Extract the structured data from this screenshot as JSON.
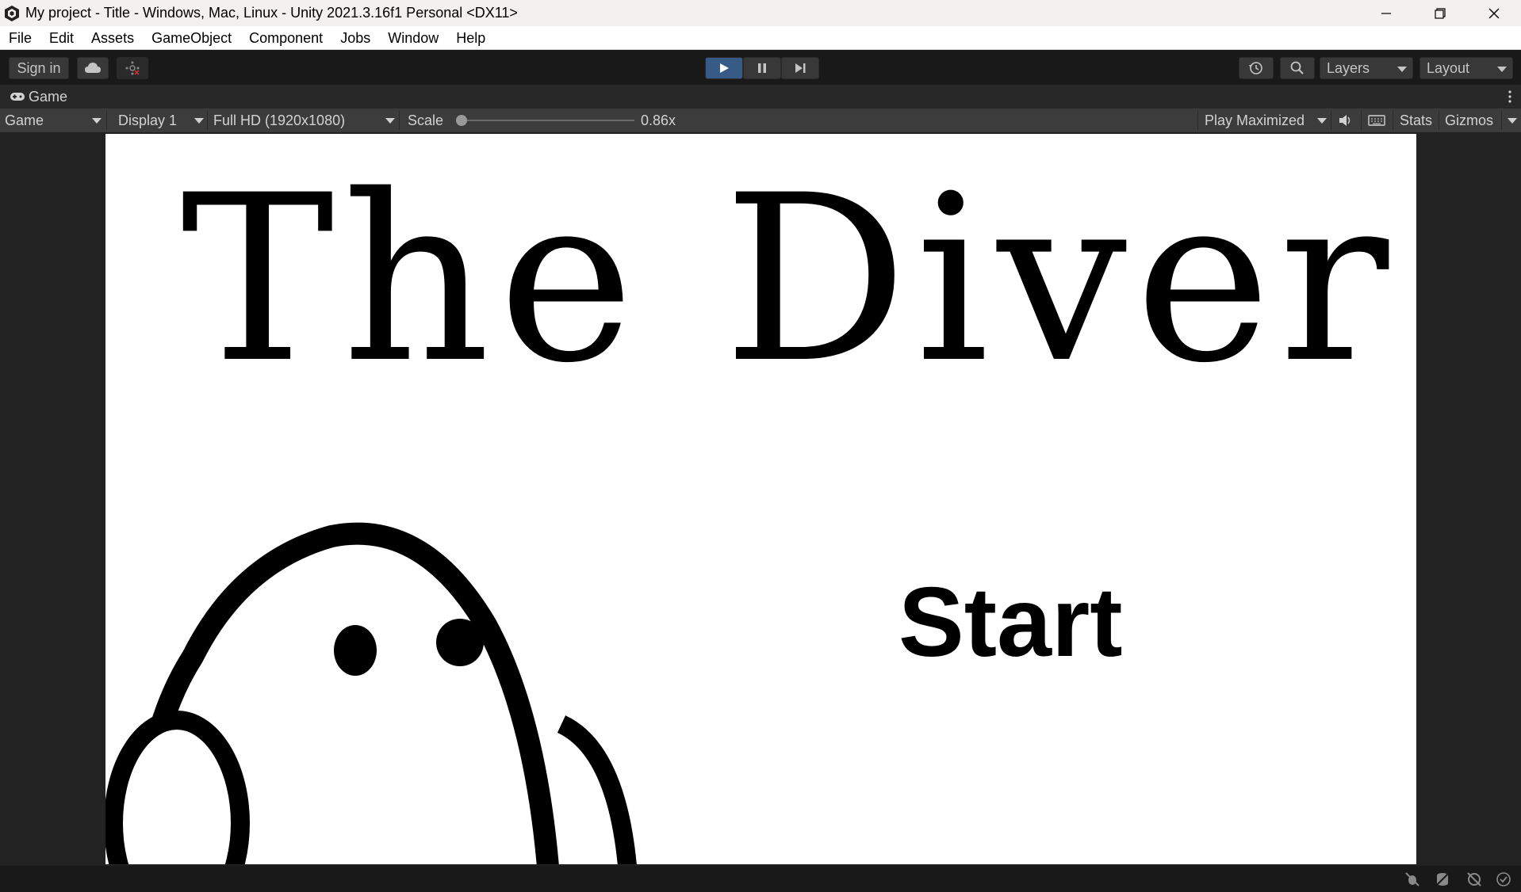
{
  "window": {
    "title": "My project - Title - Windows, Mac, Linux - Unity 2021.3.16f1 Personal <DX11>",
    "icon": "unity-logo-icon"
  },
  "menu": [
    "File",
    "Edit",
    "Assets",
    "GameObject",
    "Component",
    "Jobs",
    "Window",
    "Help"
  ],
  "toolbar": {
    "sign_in": "Sign in",
    "layers": "Layers",
    "layout": "Layout"
  },
  "tab": {
    "label": "Game"
  },
  "game_view": {
    "view_mode": "Game",
    "display": "Display 1",
    "resolution": "Full HD (1920x1080)",
    "scale_label": "Scale",
    "scale_value": "0.86x",
    "play_mode": "Play Maximized",
    "stats": "Stats",
    "gizmos": "Gizmos"
  },
  "game": {
    "title": "The Diver",
    "start": "Start"
  },
  "colors": {
    "accent": "#385a86",
    "toolbar_bg": "#191919",
    "panel_bg": "#3c3c3c"
  }
}
